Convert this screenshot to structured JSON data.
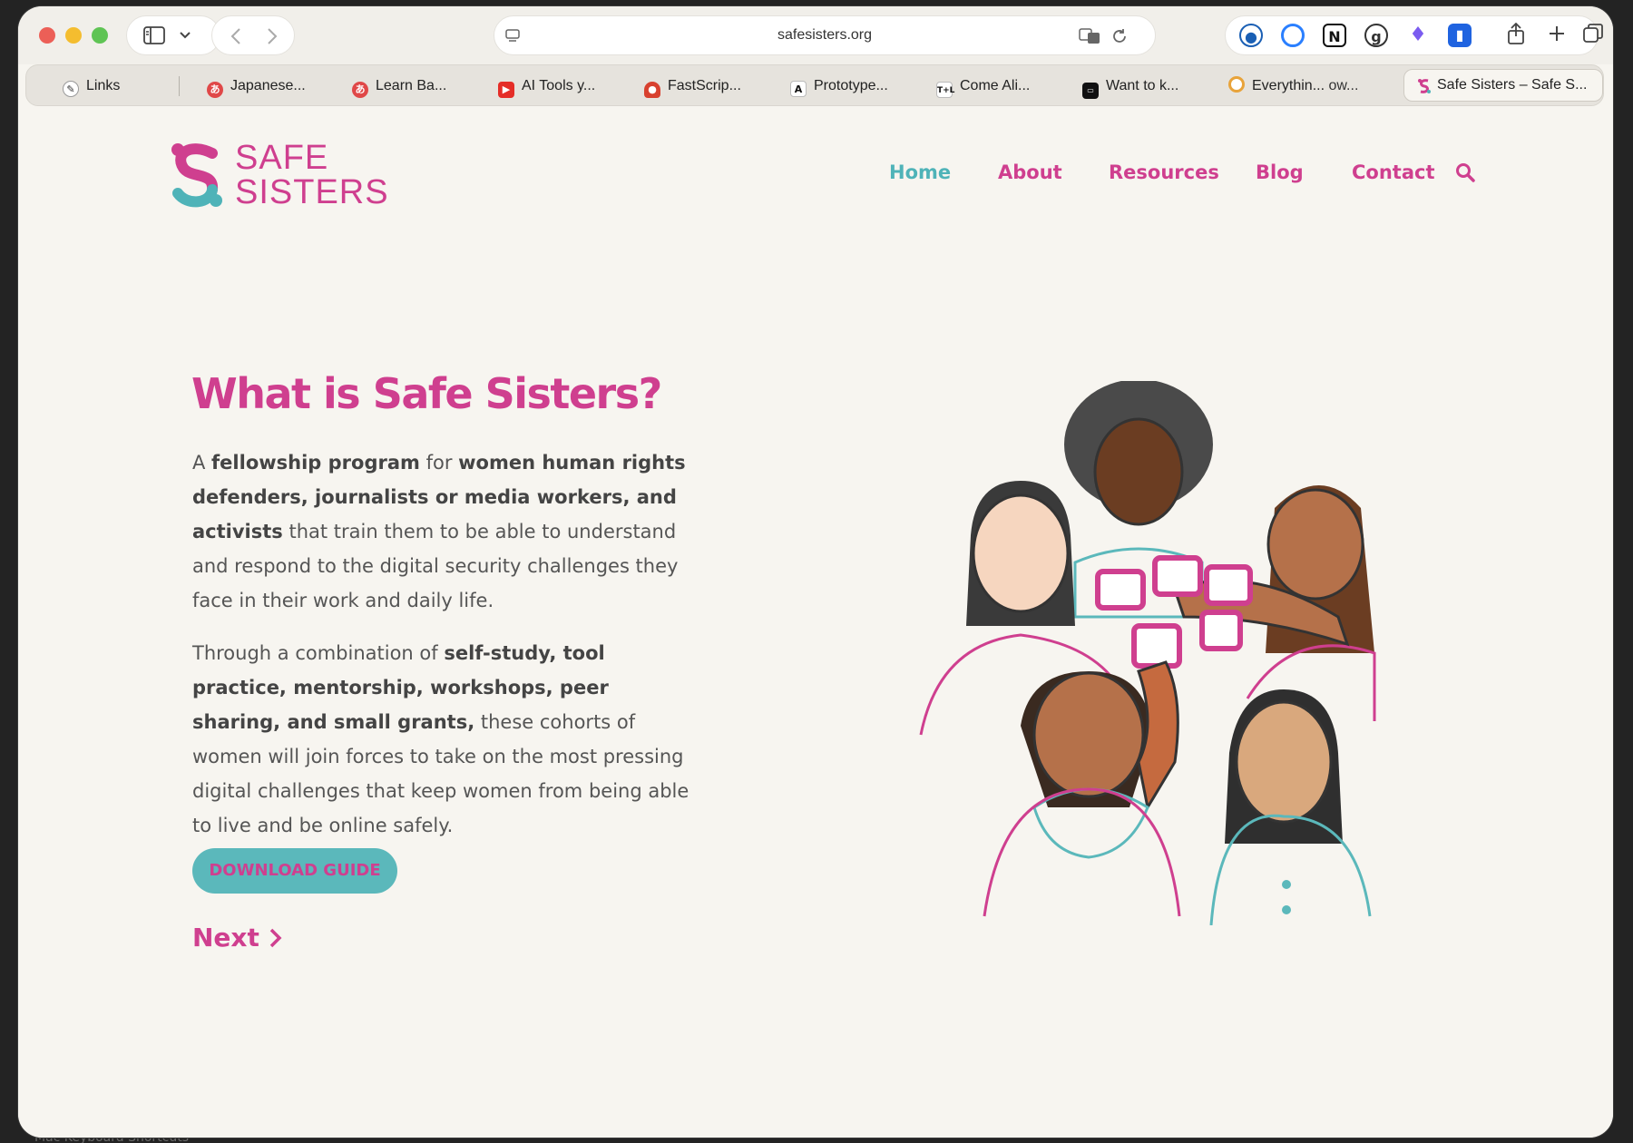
{
  "browser": {
    "url": "safesisters.org",
    "tabs": [
      {
        "label": "Links"
      },
      {
        "label": "Japanese..."
      },
      {
        "label": "Learn Ba..."
      },
      {
        "label": "AI Tools y..."
      },
      {
        "label": "FastScrip..."
      },
      {
        "label": "Prototype..."
      },
      {
        "label": "Come Ali..."
      },
      {
        "label": "Want to k..."
      },
      {
        "label": "Everythin...",
        "suffix": "ow..."
      },
      {
        "label": "Safe Sisters – Safe S..."
      }
    ]
  },
  "site": {
    "logo_line1": "SAFE",
    "logo_line2": "SISTERS",
    "nav": [
      "Home",
      "About",
      "Resources",
      "Blog",
      "Contact"
    ]
  },
  "hero": {
    "title": "What is Safe Sisters?",
    "p1": {
      "t1": "A ",
      "b1": "fellowship program",
      "t2": " for ",
      "b2": "women human rights defenders, journalists or media workers, and activists",
      "t3": " that train them to be able to understand and respond to the digital security challenges they face in their work and daily life."
    },
    "p2": {
      "t1": "Through a combination of ",
      "b1": "self-study, tool practice, mentorship, workshops, peer sharing, and small grants,",
      "t2": " these cohorts of women will join forces to take on the most pressing digital challenges that keep women from being able to live and be online safely."
    },
    "download_label": "DOWNLOAD GUIDE",
    "next_label": "Next"
  },
  "desktop_hint": "Mac Keyboard Shortcuts",
  "colors": {
    "pink": "#cf3f8f",
    "teal": "#5bb8bb",
    "page_bg": "#f7f5f0"
  }
}
